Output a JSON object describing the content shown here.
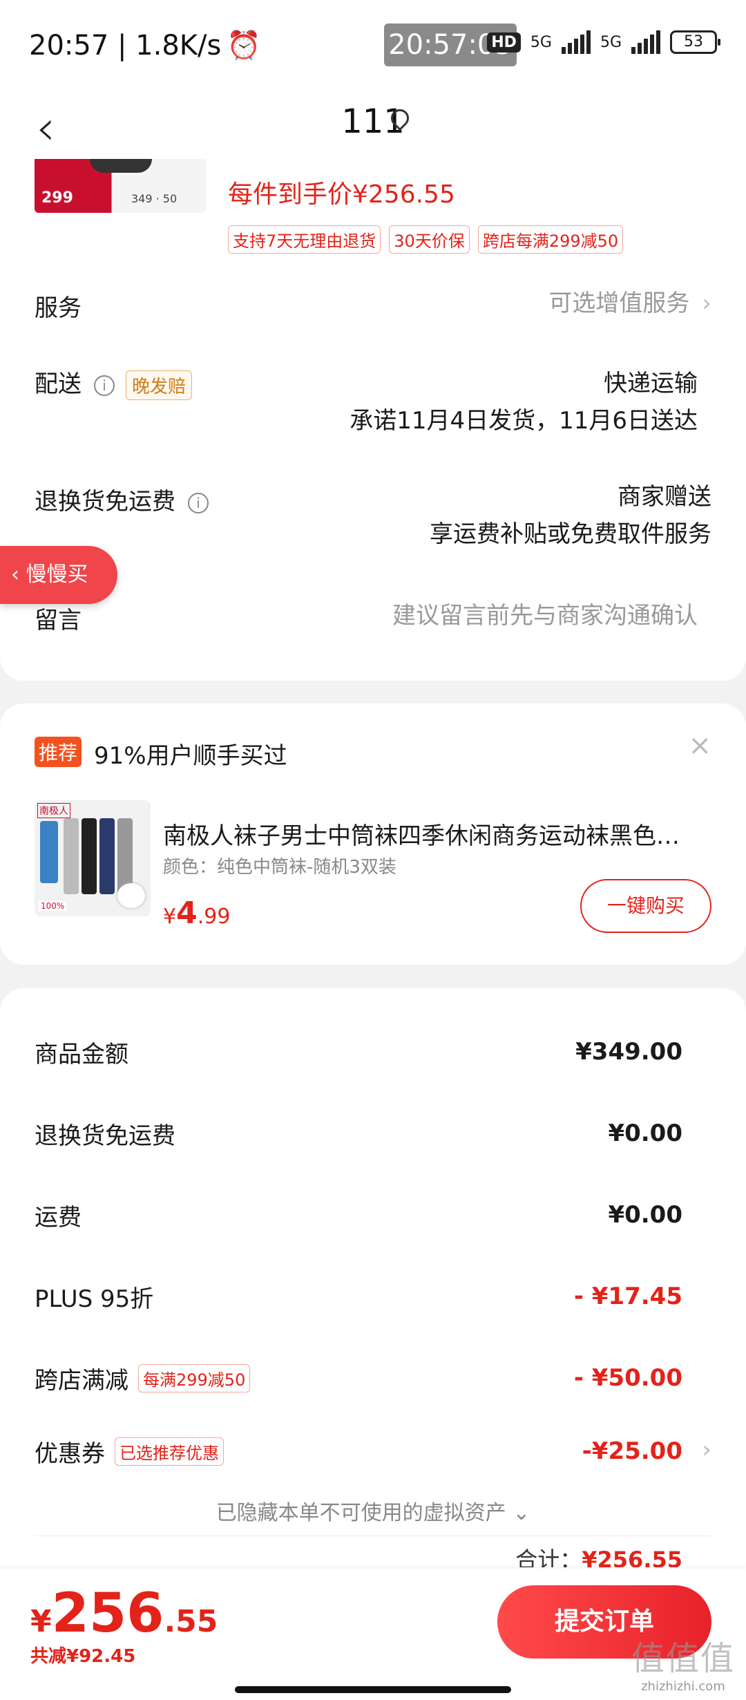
{
  "status_bar": {
    "time_speed": "20:57 | 1.8K/s",
    "center_time": "20:57:05",
    "hd": "HD",
    "net1": "5G",
    "net2": "5G",
    "battery": "53"
  },
  "nav": {
    "title": "111",
    "back_icon": "chevron-left-icon",
    "location_icon": "location-pin-icon"
  },
  "product": {
    "thumb_price": "299",
    "thumb_text": "349 · 50",
    "unit_price": "每件到手价¥256.55",
    "tags": [
      "支持7天无理由退货",
      "30天价保",
      "跨店每满299减50"
    ]
  },
  "service": {
    "label": "服务",
    "value": "可选增值服务"
  },
  "delivery": {
    "label": "配送",
    "tag": "晚发赔",
    "method": "快递运输",
    "promise": "承诺11月4日发货，11月6日送达"
  },
  "return_shipping": {
    "label": "退换货免运费",
    "value1": "商家赠送",
    "value2": "享运费补贴或免费取件服务"
  },
  "float_button": {
    "label": "慢慢买"
  },
  "message": {
    "label": "留言",
    "placeholder": "建议留言前先与商家沟通确认"
  },
  "recommend": {
    "tag": "推荐",
    "title": "91%用户顺手买过",
    "product_name": "南极人袜子男士中筒袜四季休闲商务运动袜黑色…",
    "spec": "颜色：纯色中筒袜-随机3双装",
    "price_currency": "¥",
    "price_int": "4",
    "price_dec": ".99",
    "buy_label": "一键购买"
  },
  "fees": [
    {
      "label": "商品金额",
      "value": "¥349.00",
      "tag": ""
    },
    {
      "label": "退换货免运费",
      "value": "¥0.00",
      "tag": ""
    },
    {
      "label": "运费",
      "value": "¥0.00",
      "tag": ""
    },
    {
      "label": "PLUS 95折",
      "value": "- ¥17.45",
      "tag": ""
    },
    {
      "label": "跨店满减",
      "value": "- ¥50.00",
      "tag": "每满299减50"
    },
    {
      "label": "优惠券",
      "value": "-¥25.00",
      "tag": "已选推荐优惠"
    }
  ],
  "hidden_note": "已隐藏本单不可使用的虚拟资产",
  "total_peek": {
    "label": "合计：",
    "value": "¥256.55"
  },
  "bottom": {
    "currency": "¥",
    "price_int": "256",
    "price_dec": ".55",
    "saved": "共减¥92.45",
    "submit_label": "提交订单"
  },
  "watermark": {
    "logo": "值值值",
    "url": "zhizhizhi.com"
  },
  "colors": {
    "accent": "#e2231a",
    "button": "#f0454a"
  }
}
